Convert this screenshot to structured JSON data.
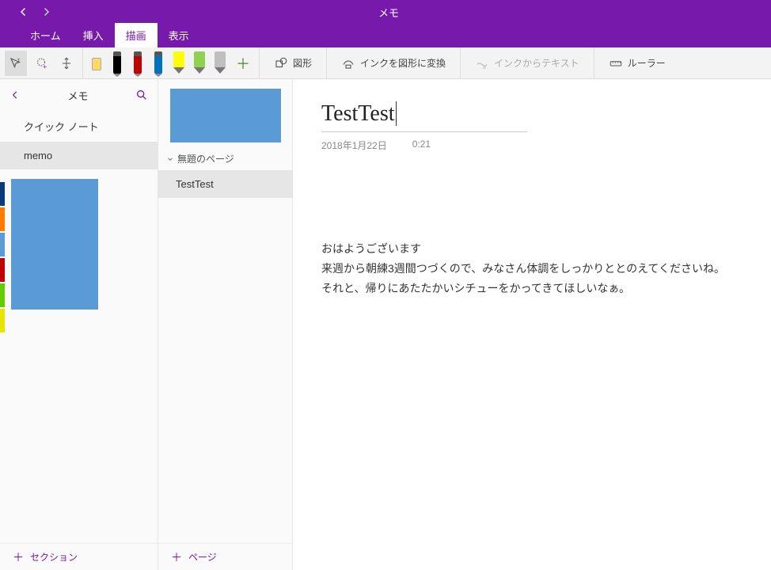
{
  "app": {
    "title": "メモ"
  },
  "tabs": {
    "home": "ホーム",
    "insert": "挿入",
    "draw": "描画",
    "view": "表示",
    "active": "draw"
  },
  "ribbon": {
    "pens": [
      {
        "color": "#FFD966",
        "kind": "eraser"
      },
      {
        "color": "#000000",
        "kind": "pen"
      },
      {
        "color": "#C00000",
        "kind": "pen"
      },
      {
        "color": "#0070C0",
        "kind": "pen"
      },
      {
        "color": "#FFFF00",
        "kind": "hl"
      },
      {
        "color": "#92D050",
        "kind": "hl"
      },
      {
        "color": "#BFBFBF",
        "kind": "hl"
      }
    ],
    "shapes": "図形",
    "ink_to_shape": "インクを図形に変換",
    "ink_to_text": "インクからテキスト",
    "ruler": "ルーラー"
  },
  "sections": {
    "search_label": "メモ",
    "items": [
      {
        "label": "クイック ノート"
      },
      {
        "label": "memo",
        "selected": true
      }
    ],
    "add_label": "セクション",
    "color_tabs": [
      "#0a3a7a",
      "#ff7b00",
      "#5B9BD5",
      "#c00000",
      "#66cc00",
      "#e6e600"
    ]
  },
  "pages": {
    "group_label": "無題のページ",
    "items": [
      {
        "label": "TestTest",
        "selected": true
      }
    ],
    "add_label": "ページ"
  },
  "note": {
    "title": "TestTest",
    "date": "2018年1月22日",
    "time": "0:21",
    "body_lines": [
      "おはようございます",
      "来週から朝練3週間つづくので、みなさん体調をしっかりととのえてくださいね。",
      "それと、帰りにあたたかいシチューをかってきてほしいなぁ。"
    ]
  }
}
